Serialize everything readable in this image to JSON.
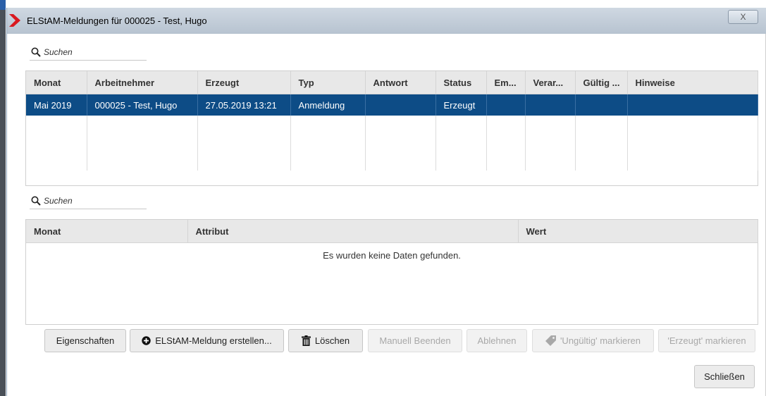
{
  "window": {
    "title": "ELStAM-Meldungen für 000025 - Test, Hugo",
    "close_label": "X"
  },
  "top_search": {
    "placeholder": "Suchen"
  },
  "top_table": {
    "columns": [
      "Monat",
      "Arbeitnehmer",
      "Erzeugt",
      "Typ",
      "Antwort",
      "Status",
      "Em...",
      "Verar...",
      "Gültig ...",
      "Hinweise"
    ],
    "rows": [
      [
        "Mai 2019",
        "000025 - Test, Hugo",
        "27.05.2019 13:21",
        "Anmeldung",
        "",
        "Erzeugt",
        "",
        "",
        "",
        ""
      ]
    ]
  },
  "bottom_search": {
    "placeholder": "Suchen"
  },
  "bottom_table": {
    "columns": [
      "Monat",
      "Attribut",
      "Wert"
    ],
    "empty_message": "Es wurden keine Daten gefunden."
  },
  "buttons": {
    "eigenschaften": "Eigenschaften",
    "erstellen": "ELStAM-Meldung erstellen...",
    "loeschen": "Löschen",
    "manuell_beenden": "Manuell Beenden",
    "ablehnen": "Ablehnen",
    "ungueltig": "'Ungültig' markieren",
    "erzeugt": "'Erzeugt' markieren",
    "schliessen": "Schließen"
  },
  "colors": {
    "selection": "#0d4c86",
    "brand_red": "#d9181f"
  },
  "icons": {
    "app": "red-chevron-icon",
    "search": "search-icon",
    "add": "plus-circle-icon",
    "delete": "trash-icon",
    "tag": "tag-icon"
  }
}
